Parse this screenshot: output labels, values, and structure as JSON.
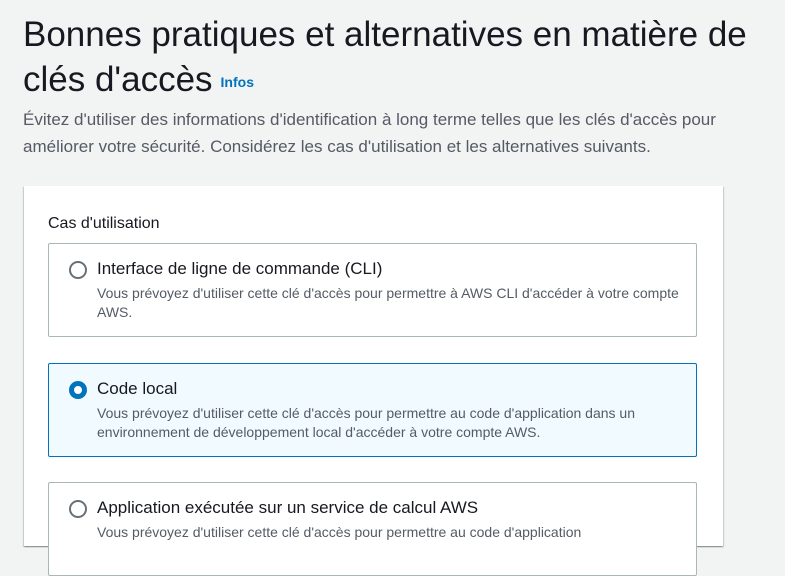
{
  "header": {
    "title": "Bonnes pratiques et alternatives en matière de clés d'accès",
    "info_link": "Infos",
    "description": "Évitez d'utiliser des informations d'identification à long terme telles que les clés d'accès pour améliorer votre sécurité. Considérez les cas d'utilisation et les alternatives suivants."
  },
  "use_cases": {
    "label": "Cas d'utilisation",
    "options": [
      {
        "title": "Interface de ligne de commande (CLI)",
        "description": "Vous prévoyez d'utiliser cette clé d'accès pour permettre à AWS CLI d'accéder à votre compte AWS.",
        "selected": false
      },
      {
        "title": "Code local",
        "description": "Vous prévoyez d'utiliser cette clé d'accès pour permettre au code d'application dans un environnement de développement local d'accéder à votre compte AWS.",
        "selected": true
      },
      {
        "title": "Application exécutée sur un service de calcul AWS",
        "description": "Vous prévoyez d'utiliser cette clé d'accès pour permettre au code d'application",
        "selected": false
      }
    ]
  },
  "colors": {
    "accent": "#0073bb",
    "selected_background": "#f1faff",
    "text_primary": "#16191f",
    "text_secondary": "#545b64"
  }
}
